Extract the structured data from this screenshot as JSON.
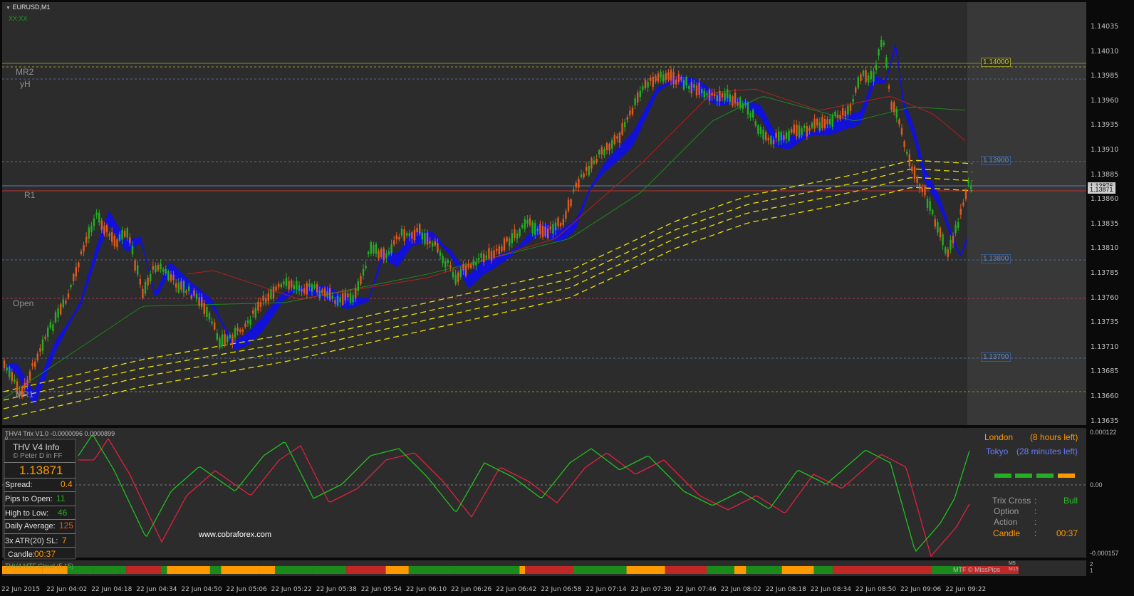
{
  "window": {
    "symbol_title": "EURUSD,M1",
    "sub_title": "XX:XX",
    "indicator_title": "THV4 Trix V1.0 -0.0000096 0.0000899",
    "indicator_zero": "0",
    "cloud_label": "THV4 MTF Cloud (5,15)",
    "cloud_right": "MTF © MissPips",
    "cloud_tf_top": "M5",
    "cloud_tf_bottom": "M15",
    "cloud_axis_top": "2",
    "cloud_axis_bottom": "1"
  },
  "levels": {
    "mr2": "MR2",
    "yh": "yH",
    "r1": "R1",
    "open": "Open",
    "mr1": "MR1"
  },
  "price_tags": {
    "p1": "1.14000",
    "p2": "1.13900",
    "p3": "1.13800",
    "p4": "1.13700",
    "current": "1.13871",
    "current_sub": "1.13876"
  },
  "price_axis": [
    "1.14035",
    "1.14010",
    "1.13985",
    "1.13960",
    "1.13935",
    "1.13910",
    "1.13885",
    "1.13860",
    "1.13835",
    "1.13810",
    "1.13785",
    "1.13760",
    "1.13735",
    "1.13710",
    "1.13685",
    "1.13660",
    "1.13635"
  ],
  "indicator_axis": {
    "top": "0.000122",
    "mid": "0.00",
    "bottom": "-0.000157"
  },
  "time_axis": [
    "22 Jun 2015",
    "22 Jun 04:02",
    "22 Jun 04:18",
    "22 Jun 04:34",
    "22 Jun 04:50",
    "22 Jun 05:06",
    "22 Jun 05:22",
    "22 Jun 05:38",
    "22 Jun 05:54",
    "22 Jun 06:10",
    "22 Jun 06:26",
    "22 Jun 06:42",
    "22 Jun 06:58",
    "22 Jun 07:14",
    "22 Jun 07:30",
    "22 Jun 07:46",
    "22 Jun 08:02",
    "22 Jun 08:18",
    "22 Jun 08:34",
    "22 Jun 08:50",
    "22 Jun 09:06",
    "22 Jun 09:22"
  ],
  "info_panel": {
    "title": "THV  V4  Info",
    "credit": "© Peter D in FF",
    "price": "1.13871",
    "spread_label": "Spread:",
    "spread_value": "0.4",
    "pips_open_label": "Pips to Open:",
    "pips_open_value": "11",
    "high_low_label": "High to Low:",
    "high_low_value": "46",
    "daily_avg_label": "Daily Average:",
    "daily_avg_value": "125",
    "atr_label": "3x ATR(20) SL:",
    "atr_value": "7",
    "candle_label": "Candle:",
    "candle_value": "00:37"
  },
  "watermark": "www.cobraforex.com",
  "sessions": {
    "london_label": "London",
    "london_left": "(8 hours left)",
    "tokyo_label": "Tokyo",
    "tokyo_left": "(28 minutes left)"
  },
  "signal_panel": {
    "trix_label": "Trix Cross",
    "trix_value": "Bull",
    "option_label": "Option",
    "action_label": "Action",
    "candle_label": "Candle",
    "candle_value": "00:37",
    "colon": ":"
  },
  "colors": {
    "bull": "#22b022",
    "bear": "#e05a1e",
    "cloud": "#1010e0",
    "ma_red": "#b02020",
    "ma_green": "#1a8a1a",
    "env_yellow": "#e8e000",
    "trix_green": "#20c020",
    "trix_red": "#e02040",
    "orange": "#ff9900",
    "tokyo": "#6a7cff"
  }
}
